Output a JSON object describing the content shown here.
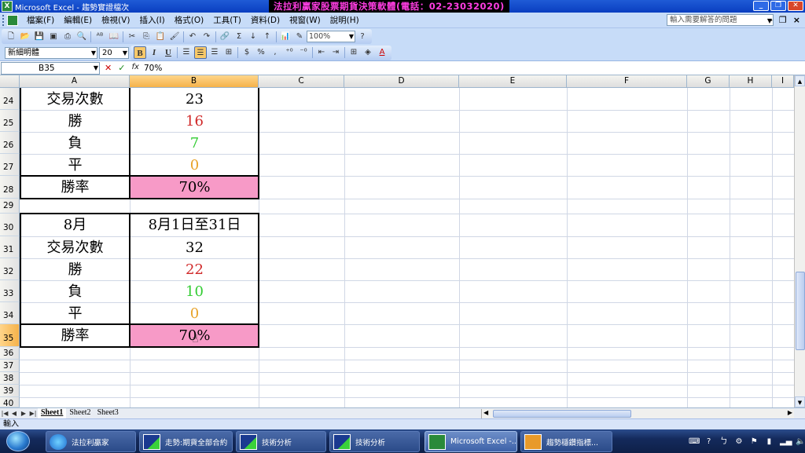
{
  "window": {
    "title": "Microsoft Excel - 趨勢實證檔次",
    "app_icon": "excel-icon",
    "promo_banner": "法拉利贏家股票期貨決策軟體(電話：02-23032020)",
    "buttons": [
      "minimize",
      "restore",
      "close"
    ]
  },
  "menubar": {
    "items": [
      "檔案(F)",
      "編輯(E)",
      "檢視(V)",
      "插入(I)",
      "格式(O)",
      "工具(T)",
      "資料(D)",
      "視窗(W)",
      "說明(H)"
    ],
    "help_placeholder": "輸入需要解答的問題"
  },
  "toolbar": {
    "zoom": "100%",
    "font_name": "新細明體",
    "font_size": "20",
    "bold_label": "B",
    "italic_label": "I",
    "underline_label": "U",
    "percent_label": "%",
    "dollar_label": "$",
    "comma_label": ","
  },
  "formula_bar": {
    "name_box": "B35",
    "fx_label": "fx",
    "content": "70%"
  },
  "columns": [
    "A",
    "B",
    "C",
    "D",
    "E",
    "F",
    "G",
    "H",
    "I"
  ],
  "rows": [
    "24",
    "25",
    "26",
    "27",
    "28",
    "29",
    "30",
    "31",
    "32",
    "33",
    "34",
    "35",
    "36",
    "37",
    "38",
    "39",
    "40"
  ],
  "cells": {
    "A24": "交易次數",
    "B24": "23",
    "A25": "勝",
    "B25": "16",
    "A26": "負",
    "B26": "7",
    "A27": "平",
    "B27": "0",
    "A28": "勝率",
    "B28": "70%",
    "A30": "8月",
    "B30": "8月1日至31日",
    "A31": "交易次數",
    "B31": "32",
    "A32": "勝",
    "B32": "22",
    "A33": "負",
    "B33": "10",
    "A34": "平",
    "B34": "0",
    "A35": "勝率",
    "B35": "70%"
  },
  "colors": {
    "win": "#d02828",
    "loss": "#33cc33",
    "draw": "#e8a32a",
    "rate_fill": "#f79ac7"
  },
  "sheet_tabs": [
    "Sheet1",
    "Sheet2",
    "Sheet3"
  ],
  "active_sheet": "Sheet1",
  "status": "輸入",
  "taskbar": {
    "items": [
      "法拉利贏家",
      "走勢:期貨全部合約",
      "技術分析",
      "技術分析",
      "Microsoft Excel -...",
      "趨勢穩鑽指標..."
    ]
  }
}
